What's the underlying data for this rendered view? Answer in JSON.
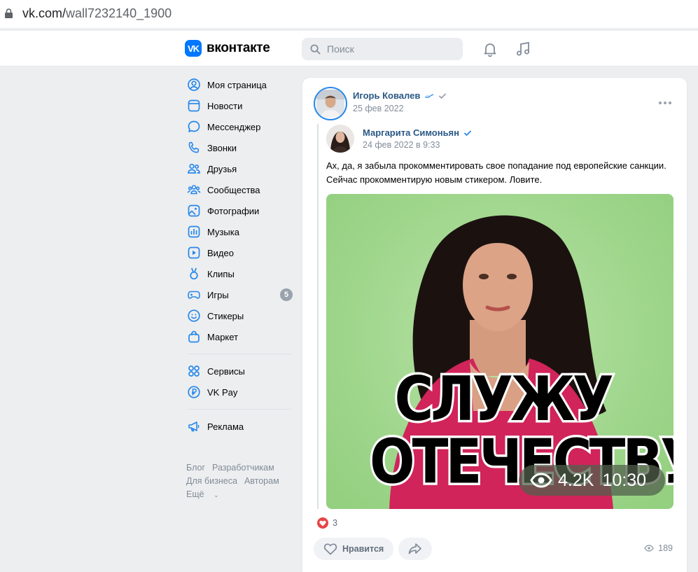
{
  "browser": {
    "url_host": "vk.com/",
    "url_path": "wall7232140_1900"
  },
  "header": {
    "logo_mark": "VK",
    "logo_text": "вконтакте",
    "search_placeholder": "Поиск"
  },
  "sidebar": {
    "items": [
      {
        "label": "Моя страница",
        "icon": "user-circle-icon"
      },
      {
        "label": "Новости",
        "icon": "newsfeed-icon"
      },
      {
        "label": "Мессенджер",
        "icon": "message-icon"
      },
      {
        "label": "Звонки",
        "icon": "phone-icon"
      },
      {
        "label": "Друзья",
        "icon": "friends-icon"
      },
      {
        "label": "Сообщества",
        "icon": "communities-icon"
      },
      {
        "label": "Фотографии",
        "icon": "photo-icon"
      },
      {
        "label": "Музыка",
        "icon": "music-icon"
      },
      {
        "label": "Видео",
        "icon": "video-icon"
      },
      {
        "label": "Клипы",
        "icon": "clips-icon"
      },
      {
        "label": "Игры",
        "icon": "gamepad-icon",
        "badge": "5"
      },
      {
        "label": "Стикеры",
        "icon": "smile-icon"
      },
      {
        "label": "Маркет",
        "icon": "bag-icon"
      }
    ],
    "items2": [
      {
        "label": "Сервисы",
        "icon": "services-icon"
      },
      {
        "label": "VK Pay",
        "icon": "vkpay-icon"
      }
    ],
    "items3": [
      {
        "label": "Реклама",
        "icon": "megaphone-icon"
      }
    ],
    "footer": {
      "blog": "Блог",
      "dev": "Разработчикам",
      "business": "Для бизнеса",
      "authors": "Авторам",
      "more": "Ещё"
    }
  },
  "post": {
    "author": "Игорь Ковалев",
    "date": "25 фев 2022",
    "repost": {
      "author": "Маргарита Симоньян",
      "date": "24 фев 2022 в 9:33",
      "text": "Ах, да, я забыла прокомментировать свое попадание под европейские санкции. Сейчас прокомментирую новым стикером. Ловите.",
      "sticker": {
        "line1": "СЛУЖУ",
        "line2": "ОТЕЧЕСТВУ",
        "views": "4.2K",
        "time": "10:30"
      }
    },
    "likes": "3",
    "like_label": "Нравится",
    "views": "189"
  },
  "colors": {
    "accent": "#0077ff",
    "link": "#2a5885",
    "icon": "#2688eb"
  }
}
